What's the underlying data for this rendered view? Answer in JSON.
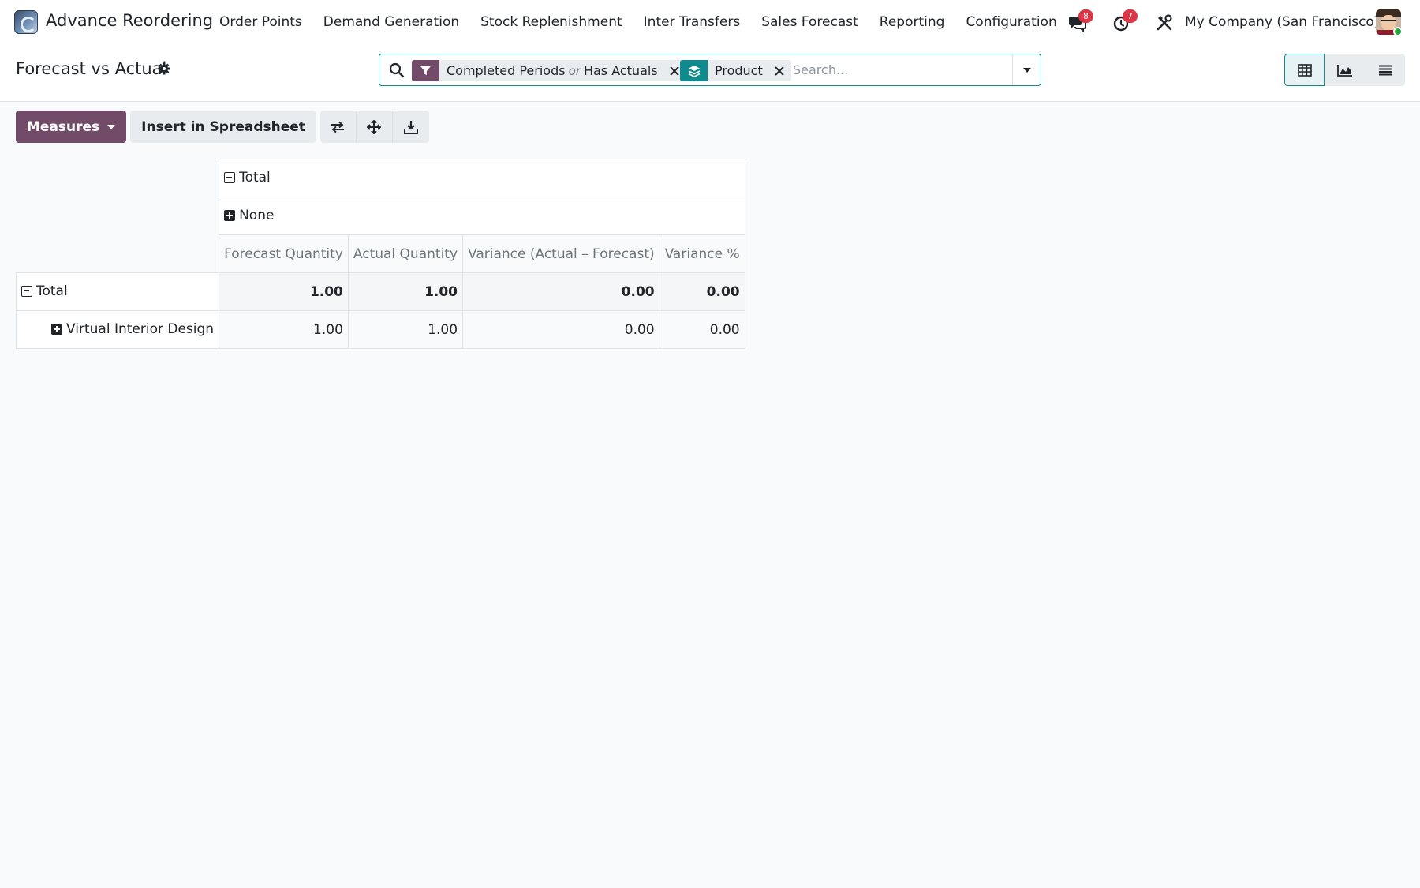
{
  "app": {
    "name": "Advance Reordering"
  },
  "menu": [
    "Order Points",
    "Demand Generation",
    "Stock Replenishment",
    "Inter Transfers",
    "Sales Forecast",
    "Reporting",
    "Configuration"
  ],
  "systray": {
    "messages_count": "8",
    "activities_count": "7",
    "company": "My Company (San Francisco)"
  },
  "page": {
    "title": "Forecast vs Actual"
  },
  "search": {
    "placeholder": "Search...",
    "filter_facet": {
      "part1": "Completed Periods",
      "separator": "or",
      "part2": "Has Actuals"
    },
    "groupby_facet": {
      "label": "Product"
    }
  },
  "toolbar": {
    "measures_label": "Measures",
    "insert_label": "Insert in Spreadsheet"
  },
  "pivot": {
    "col_total_label": "Total",
    "col_group_label": "None",
    "measures": [
      "Forecast Quantity",
      "Actual Quantity",
      "Variance (Actual – Forecast)",
      "Variance %"
    ],
    "rows": [
      {
        "label": "Total",
        "values": [
          "1.00",
          "1.00",
          "0.00",
          "0.00"
        ]
      },
      {
        "label": "Virtual Interior Design",
        "values": [
          "1.00",
          "1.00",
          "0.00",
          "0.00"
        ]
      }
    ]
  },
  "colors": {
    "brand": "#714b67",
    "accent": "#0f8b8d",
    "badge": "#dc3545",
    "online": "#28a745"
  },
  "icons": {
    "messages": "chat-bubbles-icon",
    "activities": "clock-icon",
    "debug": "tools-icon",
    "views": [
      "pivot-table-icon",
      "area-chart-icon",
      "list-icon"
    ]
  }
}
